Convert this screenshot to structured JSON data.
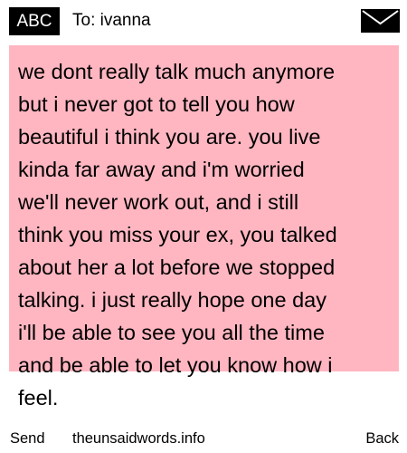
{
  "header": {
    "badge_label": "ABC",
    "to_line": "To: ivanna",
    "envelope_icon": "envelope-icon"
  },
  "message": {
    "lines": [
      "we dont really talk much anymore",
      "but i never got to tell you how",
      "beautiful i think you are. you live",
      "kinda far away and i'm worried",
      "we'll never work out, and i still",
      "think you miss your ex, you talked",
      "about her a lot before we stopped",
      "talking. i just really hope one day",
      "i'll be able to see you all the time",
      "and be able to let you know how i",
      "feel."
    ],
    "highlight_color": "#ffb6c1"
  },
  "footer": {
    "send_label": "Send",
    "site_label": "theunsaidwords.info",
    "back_label": "Back"
  }
}
